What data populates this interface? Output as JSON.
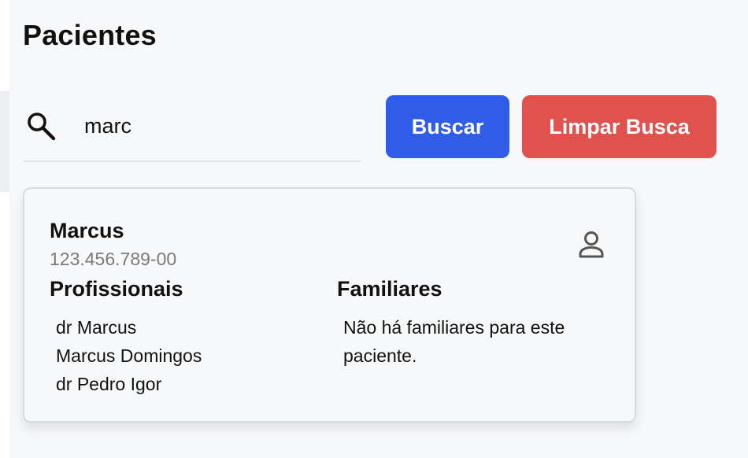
{
  "page": {
    "title": "Pacientes"
  },
  "search": {
    "value": "marc",
    "icon": "search-icon",
    "button_label": "Buscar",
    "clear_label": "Limpar Busca"
  },
  "colors": {
    "search_button": "#2f5de8",
    "clear_button": "#df524e",
    "background": "#f7f8fa"
  },
  "patient": {
    "name": "Marcus",
    "cpf": "123.456.789-00",
    "icon": "person-icon",
    "professionals_title": "Profissionais",
    "professionals": [
      "dr Marcus",
      "Marcus Domingos",
      "dr Pedro Igor"
    ],
    "family_title": "Familiares",
    "family_empty": "Não há familiares para este paciente."
  }
}
